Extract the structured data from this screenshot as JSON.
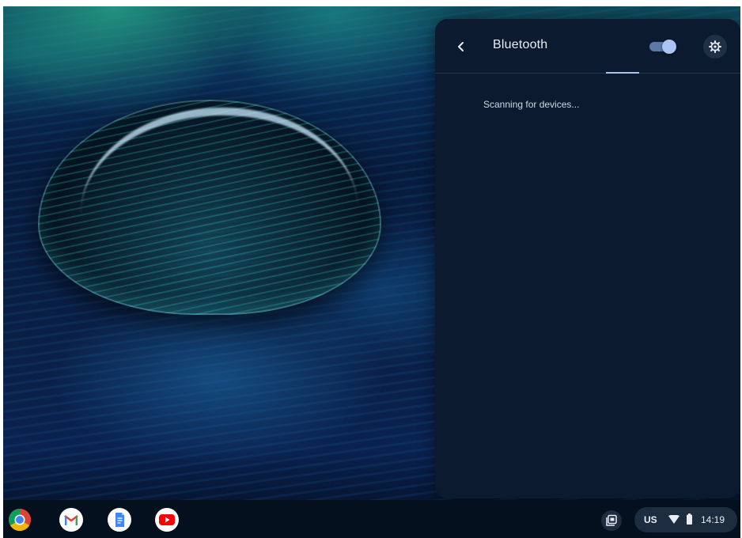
{
  "bluetooth_panel": {
    "title": "Bluetooth",
    "toggle_on": true,
    "status_text": "Scanning for devices..."
  },
  "icons": {
    "back": "back-arrow-icon",
    "settings": "gear-icon",
    "holding_space": "holding-space-icon",
    "wifi": "wifi-icon",
    "battery": "battery-icon"
  },
  "shelf": {
    "apps": [
      {
        "name": "Chrome",
        "icon": "chrome-icon"
      },
      {
        "name": "Gmail",
        "icon": "gmail-icon"
      },
      {
        "name": "Docs",
        "icon": "docs-icon"
      },
      {
        "name": "YouTube",
        "icon": "youtube-icon"
      }
    ],
    "status": {
      "ime": "US",
      "time": "14:19"
    }
  },
  "colors": {
    "panel_bg": "#0b1a2e",
    "accent": "#a9c4f5",
    "shelf_bg": "#05101e"
  }
}
